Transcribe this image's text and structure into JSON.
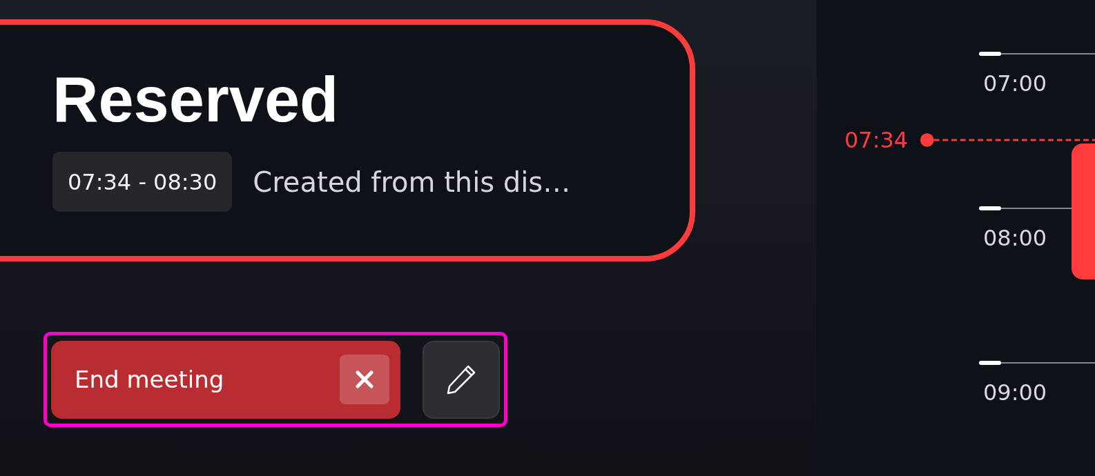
{
  "card": {
    "title": "Reserved",
    "time_range": "07:34 - 08:30",
    "description": "Created from this dis…"
  },
  "actions": [
    {
      "kind": "end",
      "label": "End meeting"
    },
    {
      "kind": "edit"
    }
  ],
  "timeline": {
    "hours": [
      "07:00",
      "08:00",
      "09:00"
    ],
    "current_time": "07:34"
  }
}
